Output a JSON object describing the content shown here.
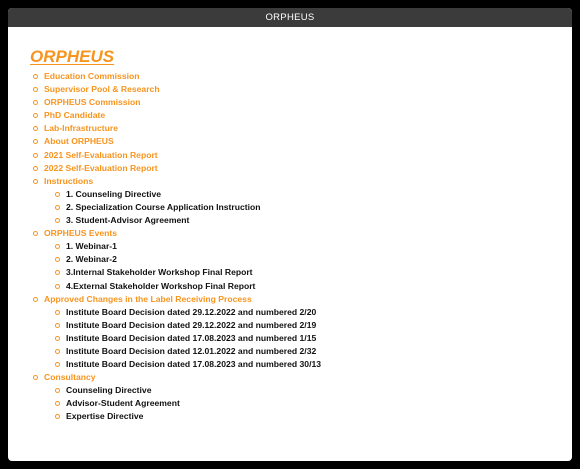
{
  "window": {
    "title": "ORPHEUS"
  },
  "heading": "ORPHEUS",
  "menu": [
    {
      "label": "Education Commission"
    },
    {
      "label": "Supervisor Pool & Research"
    },
    {
      "label": "ORPHEUS Commission"
    },
    {
      "label": "PhD Candidate"
    },
    {
      "label": "Lab-Infrastructure"
    },
    {
      "label": "About ORPHEUS"
    },
    {
      "label": "2021 Self-Evaluation Report"
    },
    {
      "label": "2022 Self-Evaluation Report"
    },
    {
      "label": "Instructions",
      "children": [
        {
          "label": "1. Counseling Directive"
        },
        {
          "label": "2. Specialization Course Application Instruction"
        },
        {
          "label": "3. Student-Advisor Agreement"
        }
      ]
    },
    {
      "label": "ORPHEUS Events",
      "children": [
        {
          "label": "1. Webinar-1"
        },
        {
          "label": "2. Webinar-2"
        },
        {
          "label": "3.Internal Stakeholder Workshop Final Report"
        },
        {
          "label": "4.External Stakeholder Workshop Final Report"
        }
      ]
    },
    {
      "label": "Approved Changes in the Label Receiving Process",
      "children": [
        {
          "label": "Institute Board Decision dated 29.12.2022 and numbered 2/20"
        },
        {
          "label": "Institute Board Decision dated 29.12.2022 and numbered 2/19"
        },
        {
          "label": "Institute Board Decision dated 17.08.2023 and numbered 1/15"
        },
        {
          "label": "Institute Board Decision dated 12.01.2022 and numbered 2/32"
        },
        {
          "label": "Institute Board Decision dated 17.08.2023 and numbered 30/13"
        }
      ]
    },
    {
      "label": "Consultancy",
      "children": [
        {
          "label": "Counseling Directive"
        },
        {
          "label": "Advisor-Student Agreement"
        },
        {
          "label": "Expertise Directive"
        }
      ]
    }
  ]
}
